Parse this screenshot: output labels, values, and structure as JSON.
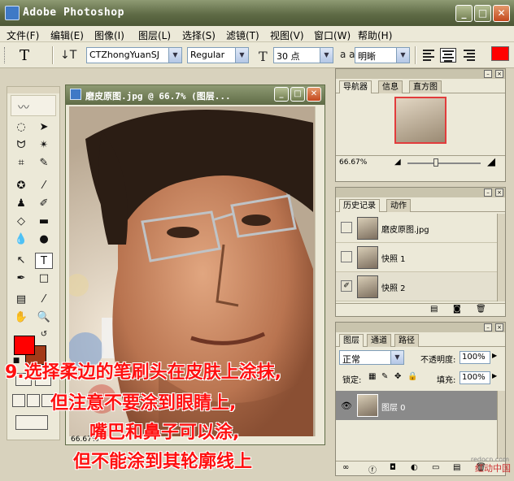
{
  "app": {
    "title": "Adobe Photoshop"
  },
  "menu": [
    "文件(F)",
    "编辑(E)",
    "图像(I)",
    "图层(L)",
    "选择(S)",
    "滤镜(T)",
    "视图(V)",
    "窗口(W)",
    "帮助(H)"
  ],
  "options": {
    "tool_glyph": "T",
    "orient_glyph": "↓T",
    "font_family": "CTZhongYuanSJ",
    "font_style": "Regular",
    "size_glyph": "T",
    "font_size": "30 点",
    "aa_glyph": "a a",
    "antialias": "明晰",
    "text_color": "#ff0000"
  },
  "document": {
    "title": "磨皮原图.jpg @ 66.7% (图层...",
    "zoom": "66.67%"
  },
  "navigator": {
    "tabs": [
      "导航器",
      "信息",
      "直方图"
    ],
    "zoom": "66.67%"
  },
  "history": {
    "tabs": [
      "历史记录",
      "动作"
    ],
    "items": [
      {
        "label": "磨皮原图.jpg"
      },
      {
        "label": "快照 1"
      },
      {
        "label": "快照 2"
      }
    ]
  },
  "layers": {
    "tabs": [
      "图层",
      "通道",
      "路径"
    ],
    "blend_mode": "正常",
    "opacity_label": "不透明度:",
    "opacity": "100%",
    "lock_label": "锁定:",
    "fill_label": "填充:",
    "fill": "100%",
    "items": [
      {
        "label": "图层 0"
      }
    ]
  },
  "caption": [
    "9.选择柔边的笔刷头在皮肤上涂抹,",
    "但注意不要涂到眼睛上,",
    "嘴巴和鼻子可以涂,",
    "但不能涂到其轮廓线上"
  ],
  "watermark": {
    "top": "redocn.com",
    "main": "红动中国"
  }
}
